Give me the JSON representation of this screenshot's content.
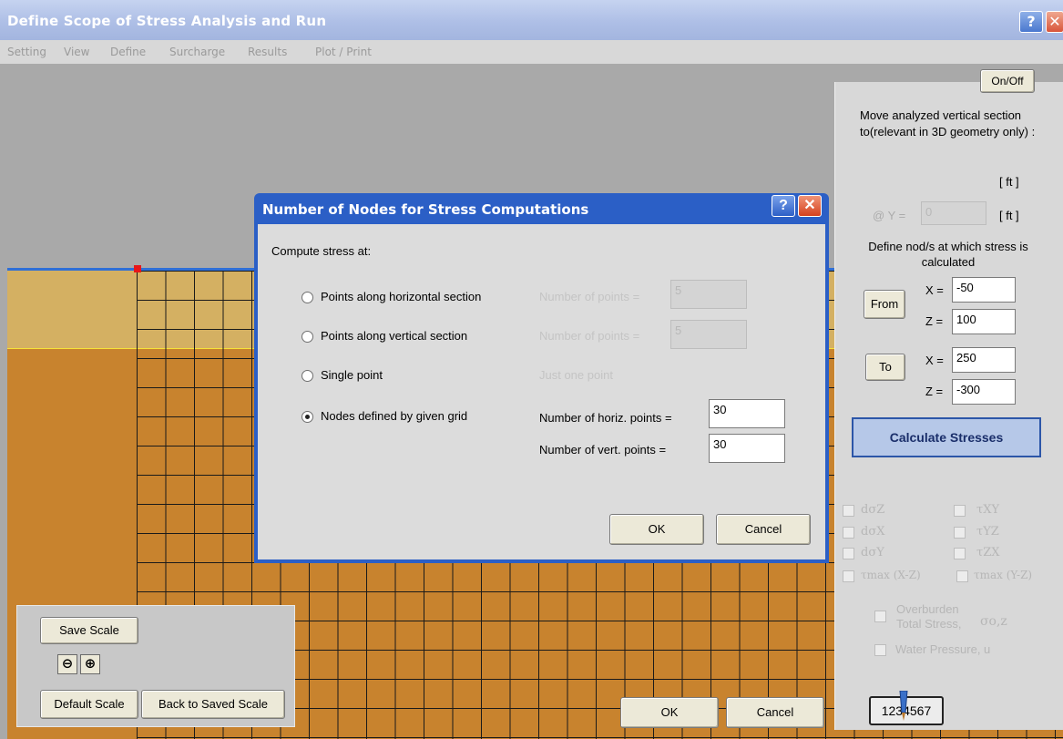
{
  "window": {
    "title": "Define Scope of Stress Analysis and Run",
    "help_glyph": "?",
    "close_glyph": "✕"
  },
  "menu": [
    "Setting",
    "View",
    "Define",
    "Surcharge",
    "Results",
    "Plot / Print"
  ],
  "scale_panel": {
    "save": "Save Scale",
    "zoom_out_glyph": "⊖",
    "zoom_in_glyph": "⊕",
    "default": "Default Scale",
    "back": "Back to Saved Scale"
  },
  "bottom_buttons": {
    "ok": "OK",
    "cancel": "Cancel"
  },
  "side": {
    "onoff": "On/Off",
    "move_text": "Move analyzed vertical section to(relevant in 3D geometry only) :",
    "unit1": "[ ft ]",
    "at_y": "@ Y =",
    "y_value": "0",
    "unit2": "[ ft ]",
    "define_text": "Define nod/s at which stress is calculated",
    "from": "From",
    "to": "To",
    "x_label": "X =",
    "z_label": "Z =",
    "from_x": "-50",
    "from_z": "100",
    "to_x": "250",
    "to_z": "-300",
    "calculate": "Calculate  Stresses",
    "checkboxes_left": [
      "dσZ",
      "dσX",
      "dσY",
      "τmax (X-Z)"
    ],
    "checkboxes_right": [
      "τXY",
      "τYZ",
      "τZX",
      "τmax (Y-Z)"
    ],
    "overburden_line1": "Overburden",
    "overburden_line2": "Total Stress,",
    "overburden_symbol": "σo,z",
    "water": "Water Pressure, u",
    "counter": "1234567"
  },
  "dialog": {
    "title": "Number of Nodes for Stress Computations",
    "help_glyph": "?",
    "close_glyph": "✕",
    "compute_label": "Compute stress at:",
    "options": [
      {
        "label": "Points along horizontal section",
        "checked": false
      },
      {
        "label": "Points along vertical section",
        "checked": false
      },
      {
        "label": "Single point",
        "checked": false
      },
      {
        "label": "Nodes defined by given grid",
        "checked": true
      }
    ],
    "num_points_label": "Number of points =",
    "num_points_h": "5",
    "num_points_v": "5",
    "just_one": "Just one point",
    "horiz_label": "Number of horiz. points =",
    "horiz_value": "30",
    "vert_label": "Number of vert. points =",
    "vert_value": "30",
    "ok": "OK",
    "cancel": "Cancel"
  }
}
